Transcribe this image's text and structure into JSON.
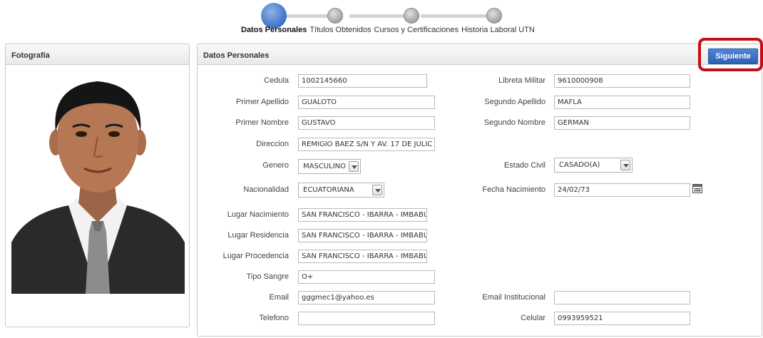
{
  "stepper": {
    "steps": [
      {
        "label": "Datos Personales",
        "active": true
      },
      {
        "label": "Títulos Obtenidos",
        "active": false
      },
      {
        "label": "Cursos y Certificaciones",
        "active": false
      },
      {
        "label": "Historia Laboral UTN",
        "active": false
      }
    ]
  },
  "photo_panel": {
    "title": "Fotografía"
  },
  "datos_panel": {
    "title": "Datos Personales",
    "next_button": "Siguiente"
  },
  "form": {
    "cedula": {
      "label": "Cedula",
      "value": "1002145660"
    },
    "libreta_militar": {
      "label": "Libreta Militar",
      "value": "9610000908"
    },
    "primer_apellido": {
      "label": "Primer Apellido",
      "value": "GUALOTO"
    },
    "segundo_apellido": {
      "label": "Segundo Apellido",
      "value": "MAFLA"
    },
    "primer_nombre": {
      "label": "Primer Nombre",
      "value": "GUSTAVO"
    },
    "segundo_nombre": {
      "label": "Segundo Nombre",
      "value": "GERMAN"
    },
    "direccion": {
      "label": "Direccion",
      "value": "REMIGIO BAEZ S/N Y AV. 17 DE JULIC"
    },
    "genero": {
      "label": "Genero",
      "value": "MASCULINO"
    },
    "estado_civil": {
      "label": "Estado Civil",
      "value": "CASADO(A)"
    },
    "nacionalidad": {
      "label": "Nacionalidad",
      "value": "ECUATORIANA"
    },
    "fecha_nacimiento": {
      "label": "Fecha Nacimiento",
      "value": "24/02/73"
    },
    "lugar_nacimiento": {
      "label": "Lugar Nacimiento",
      "value": "SAN FRANCISCO - IBARRA - IMBABU"
    },
    "lugar_residencia": {
      "label": "Lugar Residencia",
      "value": "SAN FRANCISCO - IBARRA - IMBABU"
    },
    "lugar_procedencia": {
      "label": "Lugar Procedencia",
      "value": "SAN FRANCISCO - IBARRA - IMBABU"
    },
    "tipo_sangre": {
      "label": "Tipo Sangre",
      "value": "O+"
    },
    "email": {
      "label": "Email",
      "value": "gggmec1@yahoo.es"
    },
    "email_institucional": {
      "label": "Email Institucional",
      "value": ""
    },
    "telefono": {
      "label": "Telefono",
      "value": ""
    },
    "celular": {
      "label": "Celular",
      "value": "0993959521"
    }
  },
  "colors": {
    "accent": "#3c71c8",
    "highlight_frame": "#c40d14"
  },
  "icons": {
    "calendar": "calendar-icon",
    "dropdown": "chevron-down-icon"
  }
}
